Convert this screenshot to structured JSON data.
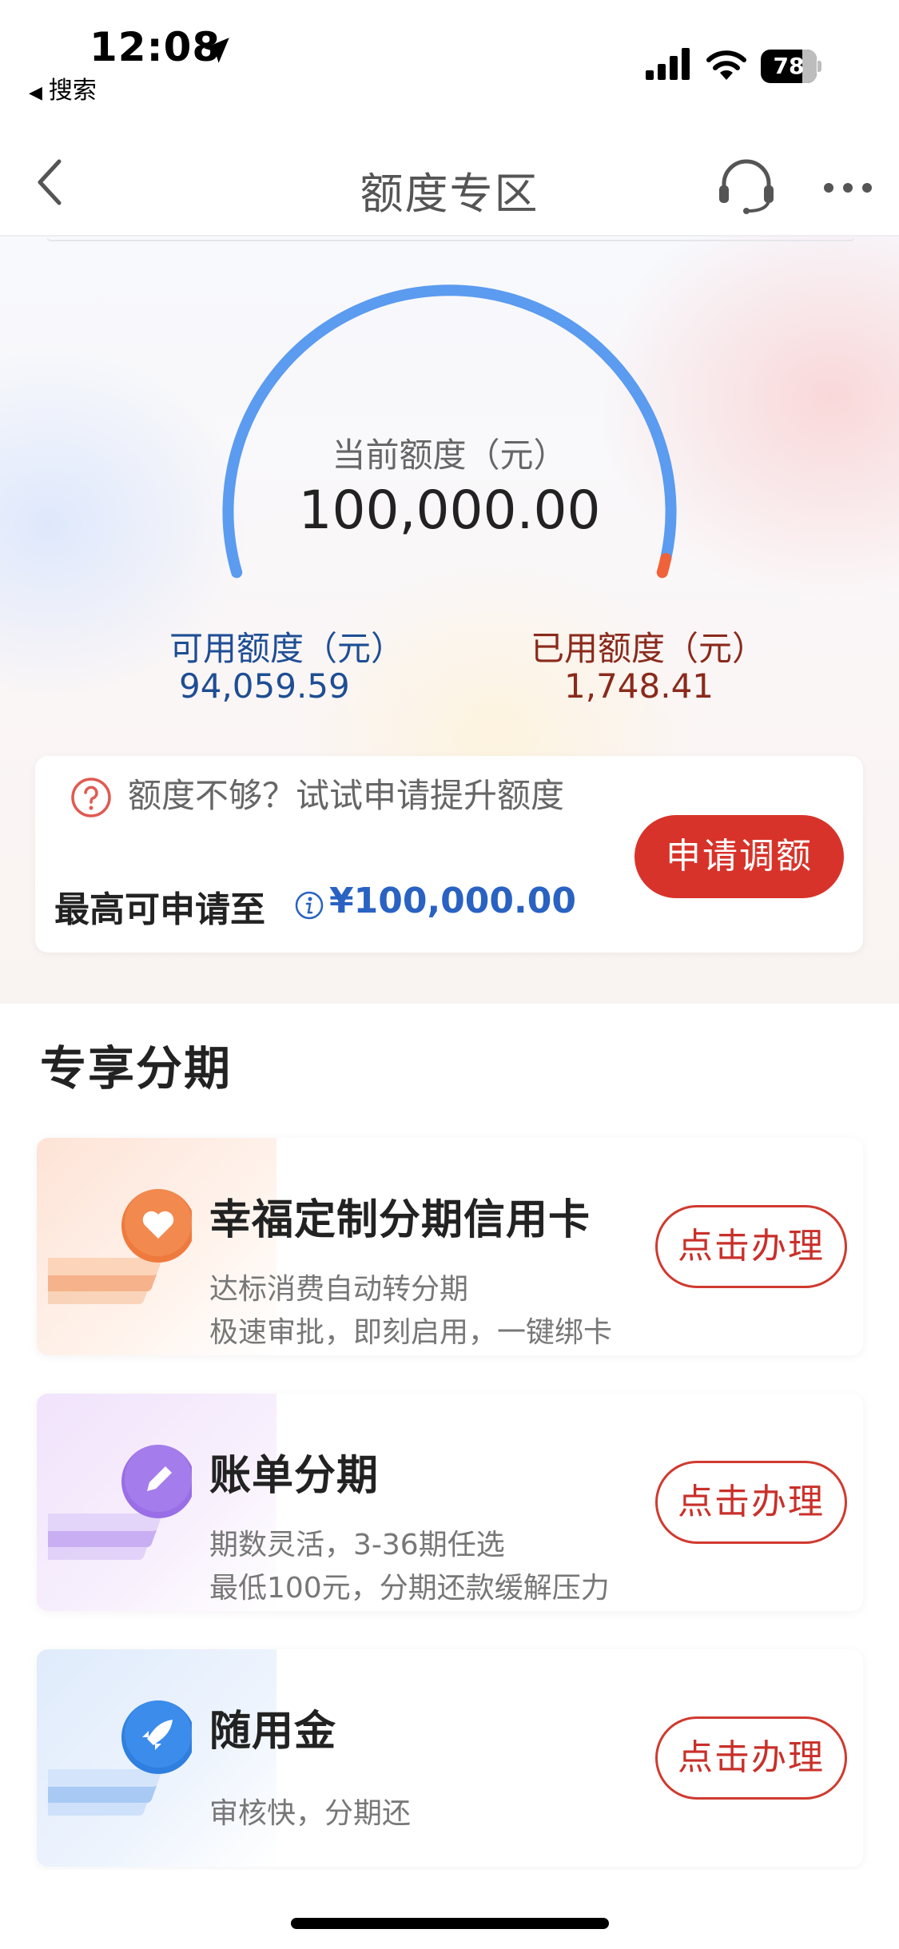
{
  "status_bar": {
    "time": "12:08",
    "back_label": "搜索",
    "battery_level": "78"
  },
  "nav": {
    "title": "额度专区",
    "icons": [
      "back-chevron-icon",
      "customer-service-icon",
      "more-icon"
    ]
  },
  "credit": {
    "current_label": "当前额度（元）",
    "current_value": "100,000.00",
    "available_label": "可用额度（元）",
    "available_value": "94,059.59",
    "used_label": "已用额度（元）",
    "used_value": "1,748.41",
    "used_fraction": 0.0175,
    "colors": {
      "arc": "#5b9bf0",
      "used_arc": "#f0623a",
      "available_text": "#1e4e94",
      "used_text": "#8a2a1c"
    }
  },
  "apply": {
    "hint": "额度不够？试试申请提升额度",
    "max_label": "最高可申请至",
    "max_value": "¥100,000.00",
    "button_label": "申请调额",
    "colors": {
      "button": "#d8332a",
      "max_value": "#2962c2"
    }
  },
  "installments": {
    "section_title": "专享分期",
    "items": [
      {
        "title": "幸福定制分期信用卡",
        "desc1": "达标消费自动转分期",
        "desc2": "极速审批，即刻启用，一键绑卡",
        "button_label": "点击办理",
        "icon": "heart-icon"
      },
      {
        "title": "账单分期",
        "desc1": "期数灵活，3-36期任选",
        "desc2": "最低100元，分期还款缓解压力",
        "button_label": "点击办理",
        "icon": "pencil-icon"
      },
      {
        "title": "随用金",
        "desc1": "审核快，分期还",
        "desc2": "",
        "button_label": "点击办理",
        "icon": "rocket-icon"
      }
    ]
  }
}
